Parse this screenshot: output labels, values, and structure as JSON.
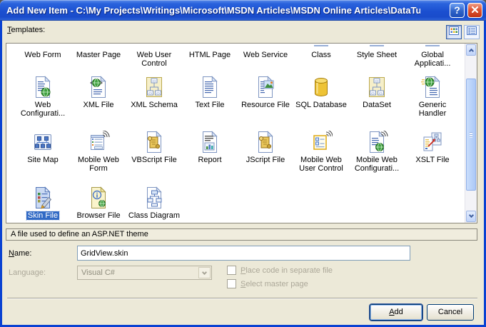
{
  "window": {
    "title": "Add New Item - C:\\My Projects\\Writings\\Microsoft\\MSDN Articles\\MSDN Online Articles\\DataTutori...",
    "help_label": "?",
    "icons": {
      "help": "help-icon",
      "close": "close-icon"
    }
  },
  "toolbar": {
    "templates_label": "Templates:",
    "view_buttons": {
      "large_icons": "large-icons-view-icon",
      "small_icons": "small-icons-view-icon"
    }
  },
  "templates": {
    "selected_item": "Skin File",
    "rows": [
      {
        "labels_only": true,
        "items": [
          {
            "label": "Web Form"
          },
          {
            "label": "Master Page"
          },
          {
            "label": "Web User Control"
          },
          {
            "label": "HTML Page"
          },
          {
            "label": "Web Service"
          },
          {
            "label": "Class",
            "cut_icon_sliver": true
          },
          {
            "label": "Style Sheet",
            "cut_icon_sliver": true
          },
          {
            "label": "Global Applicati...",
            "cut_icon_sliver": true
          }
        ]
      },
      {
        "items": [
          {
            "label": "Web Configurati...",
            "icon": "web-configuration-file-icon"
          },
          {
            "label": "XML File",
            "icon": "xml-file-icon"
          },
          {
            "label": "XML Schema",
            "icon": "xml-schema-icon"
          },
          {
            "label": "Text File",
            "icon": "text-file-icon"
          },
          {
            "label": "Resource File",
            "icon": "resource-file-icon"
          },
          {
            "label": "SQL Database",
            "icon": "sql-database-icon"
          },
          {
            "label": "DataSet",
            "icon": "dataset-icon"
          },
          {
            "label": "Generic Handler",
            "icon": "generic-handler-icon"
          }
        ]
      },
      {
        "items": [
          {
            "label": "Site Map",
            "icon": "site-map-icon"
          },
          {
            "label": "Mobile Web Form",
            "icon": "mobile-web-form-icon"
          },
          {
            "label": "VBScript File",
            "icon": "vbscript-file-icon"
          },
          {
            "label": "Report",
            "icon": "report-icon"
          },
          {
            "label": "JScript File",
            "icon": "jscript-file-icon"
          },
          {
            "label": "Mobile Web User Control",
            "icon": "mobile-web-user-control-icon"
          },
          {
            "label": "Mobile Web Configurati...",
            "icon": "mobile-web-configuration-icon"
          },
          {
            "label": "XSLT File",
            "icon": "xslt-file-icon"
          }
        ]
      },
      {
        "items": [
          {
            "label": "Skin File",
            "icon": "skin-file-icon",
            "selected": true
          },
          {
            "label": "Browser File",
            "icon": "browser-file-icon"
          },
          {
            "label": "Class Diagram",
            "icon": "class-diagram-icon"
          }
        ]
      }
    ]
  },
  "description": "A file used to define an ASP.NET theme",
  "fields": {
    "name": {
      "label": "Name:",
      "value": "GridView.skin"
    },
    "language": {
      "label": "Language:",
      "value": "Visual C#",
      "disabled": true
    }
  },
  "checkboxes": [
    {
      "label": "Place code in separate file",
      "checked": false,
      "disabled": true
    },
    {
      "label": "Select master page",
      "checked": false,
      "disabled": true
    }
  ],
  "buttons": {
    "add": "Add",
    "cancel": "Cancel"
  },
  "colors": {
    "selection": "#316AC5",
    "titlebar_blue": "#1B4FD0",
    "dialog_bg": "#ECE9D8",
    "close_red": "#DD5535"
  }
}
